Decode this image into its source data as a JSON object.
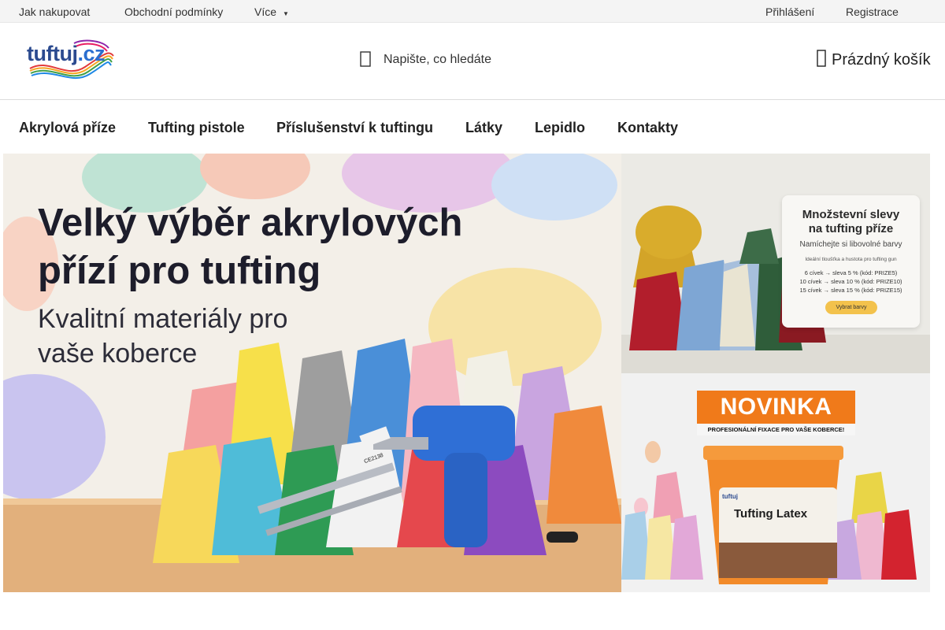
{
  "topbar": {
    "links": [
      "Jak nakupovat",
      "Obchodní podmínky",
      "Více"
    ],
    "account": [
      "Přihlášení",
      "Registrace"
    ]
  },
  "header": {
    "logo": {
      "name": "tuftuj",
      "tld": ".cz"
    },
    "search_placeholder": "Napište, co hledáte",
    "cart_label": "Prázdný košík"
  },
  "nav": {
    "items": [
      "Akrylová příze",
      "Tufting pistole",
      "Příslušenství k tuftingu",
      "Látky",
      "Lepidlo",
      "Kontakty"
    ]
  },
  "hero": {
    "title_line1": "Velký výběr akrylových",
    "title_line2": "přízí pro tufting",
    "subtitle_line1": "Kvalitní materiály pro",
    "subtitle_line2": "vaše koberce",
    "gun_label": "CE2138"
  },
  "promo": {
    "title_line1": "Množstevní slevy",
    "title_line2": "na tufting příze",
    "subtitle": "Namíchejte si libovolné barvy",
    "info": "Ideální tloušťka a hustota pro tufting gun",
    "tiers": [
      "6 cívek → sleva 5 % (kód: PRIZE5)",
      "10 cívek → sleva 10 % (kód: PRIZE10)",
      "15 cívek → sleva 15 % (kód: PRIZE15)"
    ],
    "button": "Vybrat barvy"
  },
  "novinka": {
    "badge": "NOVINKA",
    "strip": "PROFESIONÁLNÍ FIXACE PRO VAŠE KOBERCE!",
    "product": "Tufting Latex",
    "brand": "tuftuj"
  },
  "colors": {
    "accent_orange": "#f07a1a",
    "logo_blue": "#2b4a8f",
    "promo_button": "#f3c24c",
    "topbar_bg": "#f4f4f4"
  }
}
